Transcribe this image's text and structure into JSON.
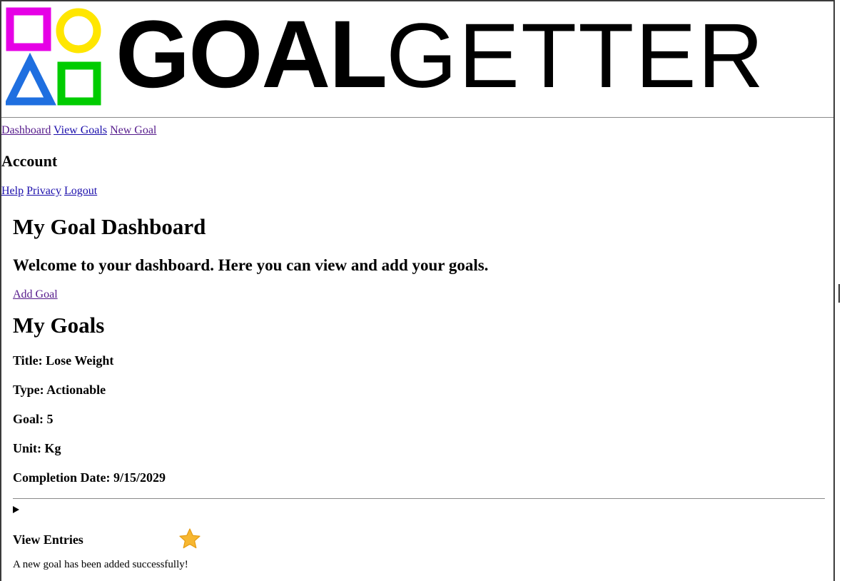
{
  "logo": {
    "word_bold": "GOAL",
    "word_light": "GETTER",
    "colors": {
      "square": "#e600e6",
      "circle": "#ffe600",
      "triangle": "#1f6fe0",
      "square_green": "#00cc00"
    }
  },
  "nav": {
    "dashboard": "Dashboard",
    "view_goals": "View Goals",
    "new_goal": "New Goal"
  },
  "account": {
    "title": "Account",
    "help": "Help",
    "privacy": "Privacy",
    "logout": "Logout"
  },
  "main": {
    "title": "My Goal Dashboard",
    "welcome": "Welcome to your dashboard. Here you can view and add your goals.",
    "add_goal": "Add Goal",
    "goals_title": "My Goals",
    "goal": {
      "title": "Title: Lose Weight",
      "type": "Type: Actionable",
      "goal": "Goal: 5",
      "unit": "Unit: Kg",
      "completion": "Completion Date: 9/15/2029"
    },
    "view_entries": "View Entries",
    "star_icon": "star-icon",
    "toast": "A new goal has been added successfully!"
  }
}
